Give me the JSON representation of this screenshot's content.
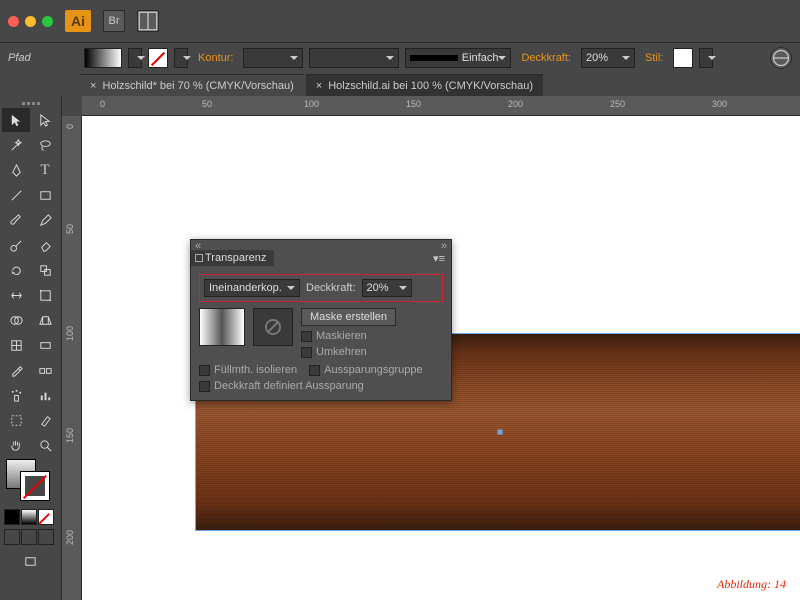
{
  "app": {
    "label": "Ai",
    "br": "Br"
  },
  "controlbar": {
    "path": "Pfad",
    "kontur": "Kontur:",
    "stroke_style": "Einfach",
    "deckkraft_label": "Deckkraft:",
    "deckkraft_value": "20%",
    "stil": "Stil:"
  },
  "tabs": [
    {
      "label": "Holzschild* bei 70 % (CMYK/Vorschau)",
      "active": true
    },
    {
      "label": "Holzschild.ai bei 100 % (CMYK/Vorschau)",
      "active": false
    }
  ],
  "ruler_h": [
    "0",
    "50",
    "100",
    "150",
    "200",
    "250",
    "300"
  ],
  "ruler_v": [
    "0",
    "50",
    "100",
    "150",
    "200"
  ],
  "panel": {
    "title": "Transparenz",
    "blendmode": "Ineinanderkop.",
    "deckkraft_label": "Deckkraft:",
    "deckkraft_value": "20%",
    "create_mask": "Maske erstellen",
    "maskieren": "Maskieren",
    "umkehren": "Umkehren",
    "isolate": "Füllmth. isolieren",
    "knockout": "Aussparungsgruppe",
    "define": "Deckkraft definiert Aussparung"
  },
  "caption": "Abbildung: 14"
}
